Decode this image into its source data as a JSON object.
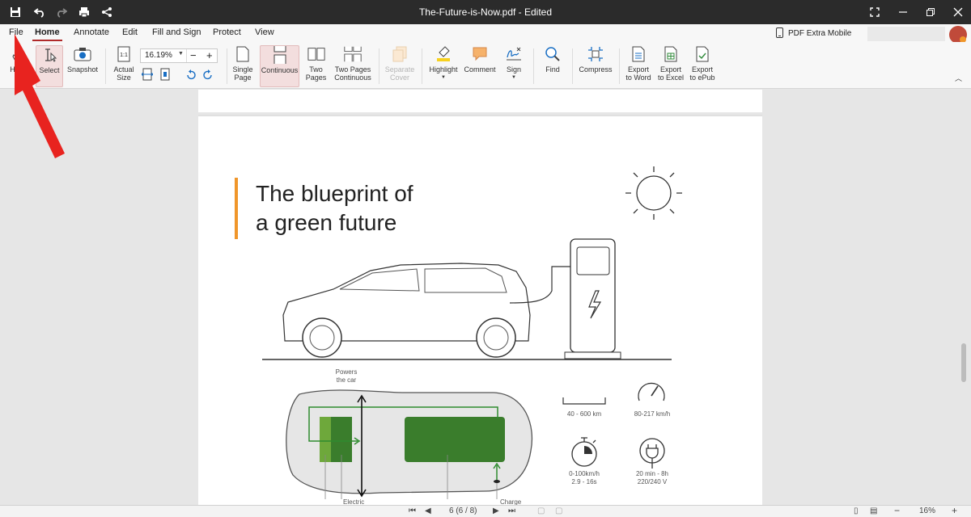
{
  "window": {
    "title": "The-Future-is-Now.pdf - Edited"
  },
  "menu": {
    "items": [
      "File",
      "Home",
      "Annotate",
      "Edit",
      "Fill and Sign",
      "Protect",
      "View"
    ],
    "active": "Home",
    "mobile_label": "PDF Extra Mobile"
  },
  "ribbon": {
    "hand": "Hand",
    "select": "Select",
    "snapshot": "Snapshot",
    "actual_size": "Actual Size",
    "zoom_value": "16.19%",
    "single_page": "Single Page",
    "continuous": "Continuous",
    "two_pages": "Two Pages",
    "two_pages_continuous": "Two Pages Continuous",
    "separate_cover": "Separate Cover",
    "highlight": "Highlight",
    "comment": "Comment",
    "sign": "Sign",
    "find": "Find",
    "compress": "Compress",
    "export_word": "Export to Word",
    "export_excel": "Export to Excel",
    "export_epub": "Export to ePub"
  },
  "document": {
    "heading_line1": "The blueprint of",
    "heading_line2": "a green future",
    "powers_label": "Powers the car",
    "electric_label": "Electric",
    "charge_label": "Charge",
    "stat_range": "40 - 600 km",
    "stat_speed": "80-217 km/h",
    "stat_accel": "0-100km/h\n2.9 - 16s",
    "stat_charge": "20 min - 8h\n220/240 V"
  },
  "status": {
    "page_indicator": "6 (6 / 8)",
    "zoom": "16%"
  },
  "colors": {
    "titlebar": "#2b2b2b",
    "accent_red": "#b02a2a",
    "orange_bar": "#f0962a",
    "battery_green": "#3a7d2c",
    "arrow_red": "#e8231f"
  }
}
